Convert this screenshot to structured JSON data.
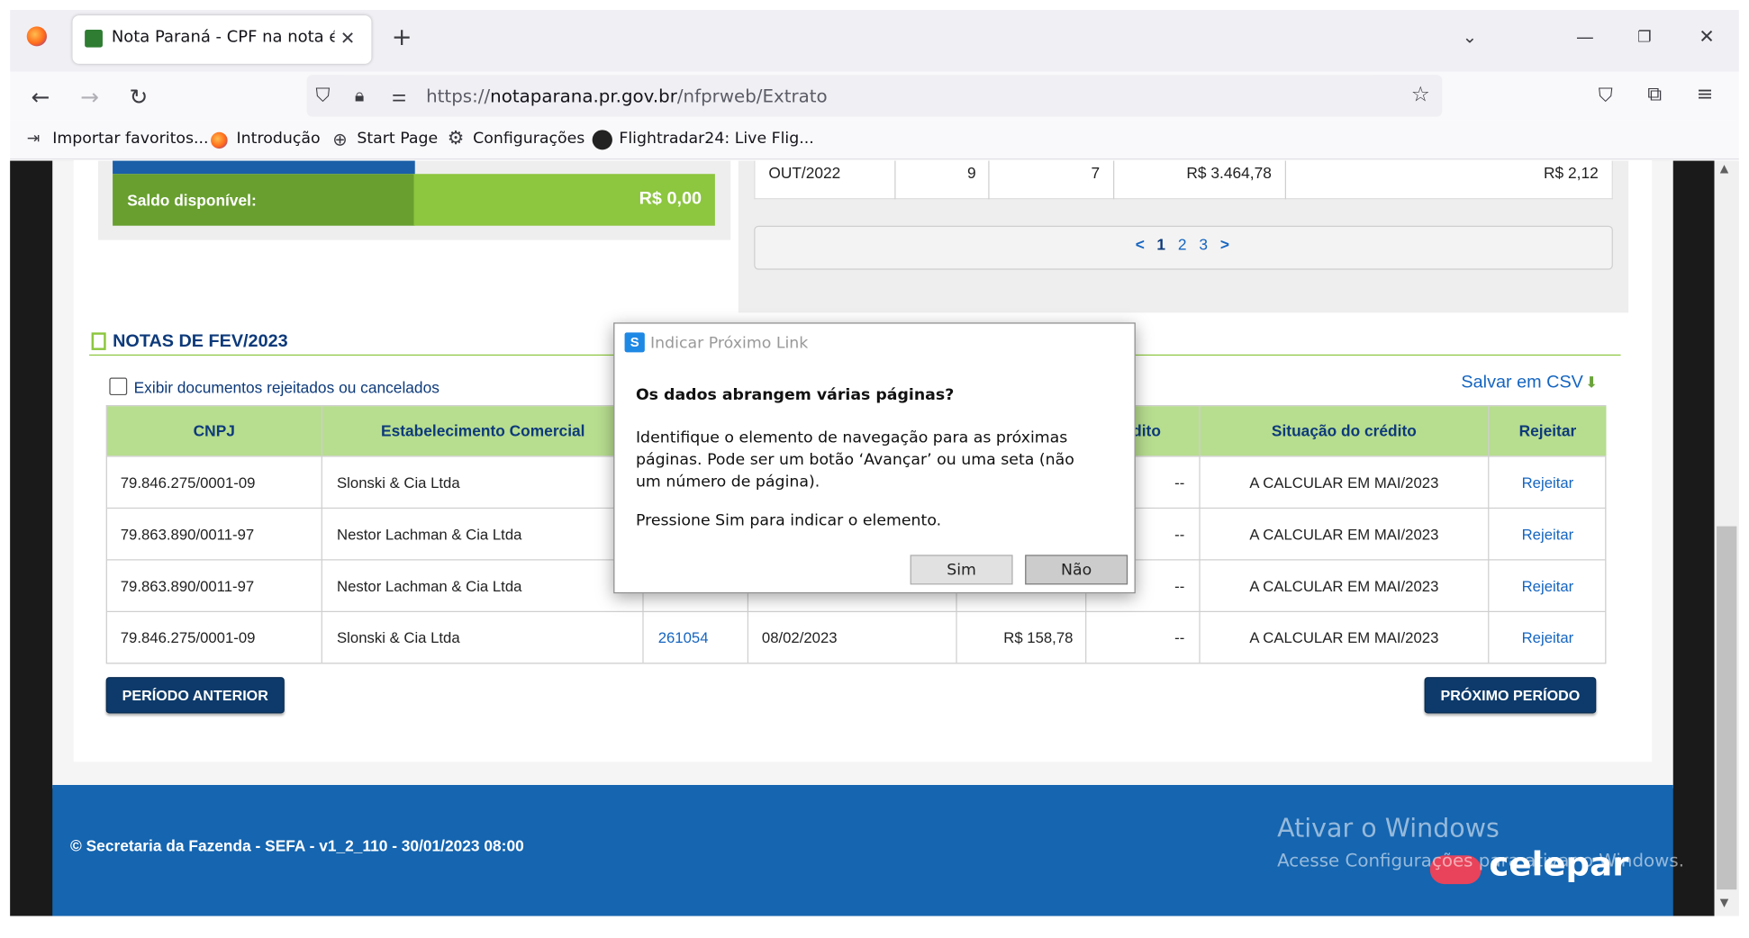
{
  "browser": {
    "tab_title": "Nota Paraná - CPF na nota é din",
    "url_prefix": "https://",
    "url_host": "notaparana.pr.gov.br",
    "url_path": "/nfprweb/Extrato",
    "bookmarks": [
      {
        "label": "Importar favoritos..."
      },
      {
        "label": "Introdução"
      },
      {
        "label": "Start Page"
      },
      {
        "label": "Configurações"
      },
      {
        "label": "Flightradar24: Live Flig..."
      }
    ]
  },
  "saldo": {
    "label": "Saldo disponível:",
    "value": "R$ 0,00"
  },
  "summary_row": {
    "month": "OUT/2022",
    "col2": "9",
    "col3": "7",
    "total": "R$ 3.464,78",
    "credit": "R$ 2,12"
  },
  "pager": {
    "prev": "<",
    "pages": [
      "1",
      "2",
      "3"
    ],
    "next": ">"
  },
  "notas": {
    "title": "NOTAS DE FEV/2023",
    "checkbox_label": "Exibir documentos rejeitados ou cancelados",
    "csv_label": "Salvar em CSV",
    "headers": [
      "CNPJ",
      "Estabelecimento Comercial",
      "",
      "",
      "",
      "édito",
      "Situação do crédito",
      "Rejeitar"
    ],
    "rows": [
      {
        "cnpj": "79.846.275/0001-09",
        "estab": "Slonski & Cia Ltda",
        "num": "",
        "date": "",
        "value": "",
        "credit": "--",
        "situacao": "A CALCULAR EM MAI/2023",
        "action": "Rejeitar"
      },
      {
        "cnpj": "79.863.890/0011-97",
        "estab": "Nestor Lachman & Cia Ltda",
        "num": "",
        "date": "",
        "value": "",
        "credit": "--",
        "situacao": "A CALCULAR EM MAI/2023",
        "action": "Rejeitar"
      },
      {
        "cnpj": "79.863.890/0011-97",
        "estab": "Nestor Lachman & Cia Ltda",
        "num": "",
        "date": "",
        "value": "",
        "credit": "--",
        "situacao": "A CALCULAR EM MAI/2023",
        "action": "Rejeitar"
      },
      {
        "cnpj": "79.846.275/0001-09",
        "estab": "Slonski & Cia Ltda",
        "num": "261054",
        "date": "08/02/2023",
        "value": "R$ 158,78",
        "credit": "--",
        "situacao": "A CALCULAR EM MAI/2023",
        "action": "Rejeitar"
      }
    ],
    "prev_button": "PERÍODO ANTERIOR",
    "next_button": "PRÓXIMO PERÍODO"
  },
  "footer": {
    "copyright": "© Secretaria da Fazenda - SEFA - v1_2_110 - 30/01/2023 08:00",
    "watermark_title": "Ativar o Windows",
    "watermark_sub": "Acesse Configurações para ativar o Windows.",
    "brand": "celepar"
  },
  "dialog": {
    "title": "Indicar Próximo Link",
    "heading": "Os dados abrangem várias páginas?",
    "body1": "Identifique o elemento de navegação para as próximas páginas. Pode ser um botão ‘Avançar’ ou uma seta (não um número de página).",
    "body2": "Pressione Sim para indicar o elemento.",
    "yes": "Sim",
    "no": "Não"
  }
}
